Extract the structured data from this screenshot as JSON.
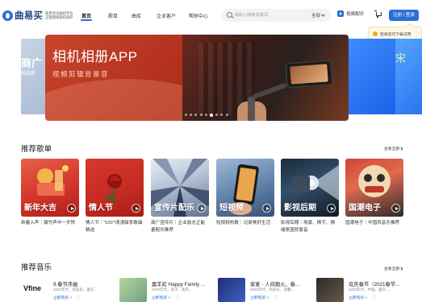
{
  "brand": {
    "name": "曲易买",
    "slogan": "商用音乐版权平台正版授权版权保护"
  },
  "nav": [
    {
      "label": "首页",
      "active": true
    },
    {
      "label": "歌单",
      "active": false
    },
    {
      "label": "曲库",
      "active": false
    },
    {
      "label": "企业客户",
      "active": false
    },
    {
      "label": "帮助中心",
      "active": false
    }
  ],
  "search": {
    "placeholder": "请输入搜索关键词",
    "scope": "全部"
  },
  "header": {
    "video_config": "视频配乐",
    "login": "注册 | 登录",
    "login_tip": "登录后可下载试用"
  },
  "banner": {
    "title": "相机相册APP",
    "subtitle": "视频剪辑背景音",
    "left_title": "商广",
    "left_sub": "科技感",
    "right_title": "宋",
    "right_sub": "",
    "dots": 9,
    "active_dot": 5
  },
  "playlists": {
    "title": "推荐歌单",
    "more": "查看全部",
    "items": [
      {
        "label": "新年大吉",
        "desc": "新春入声｜爆竹声中一岁除"
      },
      {
        "label": "情人节",
        "desc": "情人节｜“520”!浪漫甜系歌曲精选"
      },
      {
        "label": "宣传片配乐",
        "desc": "商广宣传片｜企业励志正能量配乐推荐"
      },
      {
        "label": "短视频",
        "desc": "短视频热歌｜记录美好生活"
      },
      {
        "label": "影视后期",
        "desc": "影视后期｜场景、情节、情绪氛围背景音"
      },
      {
        "label": "国潮电子",
        "desc": "国潮电子｜中国风音乐推荐"
      }
    ]
  },
  "music": {
    "title": "推荐音乐",
    "more": "查看全部",
    "tracks": [
      {
        "title": "9.春节序曲",
        "meta": "2020年代，民族乐，喜庆...",
        "link": "立即购买 >",
        "cover": "Vfine"
      },
      {
        "title": "属羊虹 Happy Family ...",
        "meta": "2020年代，电子，喜庆...",
        "link": "立即购买 >",
        "cover": ""
      },
      {
        "title": "家宴 - 人间烟火，春...",
        "meta": "2020年代，民族乐，温馨...",
        "link": "立即购买 >",
        "cover": ""
      },
      {
        "title": "欢庆春节（2021春节...",
        "meta": "2020年代，中国，喜庆...",
        "link": "立即购买 >",
        "cover": ""
      }
    ]
  },
  "colors": {
    "accent": "#2b6fd6",
    "banner": "#b3311e"
  }
}
